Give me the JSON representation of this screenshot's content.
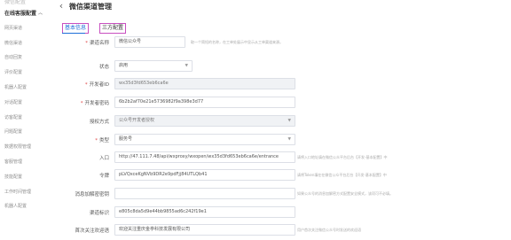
{
  "sidebar": {
    "top_text": "微信配置",
    "group_label": "在线客服配置",
    "items": [
      {
        "label": "网页渠道"
      },
      {
        "label": "微信渠道"
      },
      {
        "label": "自动回复"
      },
      {
        "label": "评价配置"
      },
      {
        "label": "机器人配置"
      },
      {
        "label": "对话配置"
      },
      {
        "label": "访客配置"
      },
      {
        "label": "问题配置"
      },
      {
        "label": "数据权限管理"
      },
      {
        "label": "客服管理"
      },
      {
        "label": "技能配置"
      },
      {
        "label": "工作时间管理"
      },
      {
        "label": "机器人配置"
      }
    ]
  },
  "header": {
    "back_icon": "‹",
    "title": "微信渠道管理"
  },
  "tabs": [
    {
      "label": "基本信息",
      "active": true
    },
    {
      "label": "三方配置",
      "active": false
    }
  ],
  "form": {
    "channel_name": {
      "label": "渠道名称",
      "value": "微信公众号",
      "hint": "取一个简短的名称，在工单处展示中显示从工单渠道来源。"
    },
    "status": {
      "label": "状态",
      "value": "启用"
    },
    "developer_id": {
      "label": "开发者ID",
      "value": "wx35d3fd653eb6ca6e"
    },
    "developer_secret": {
      "label": "开发者密码",
      "value": "6b2b2af70e21e5736982f9a398e3d77"
    },
    "auth_method": {
      "label": "授权方式",
      "value": "公众号开发者授权"
    },
    "type": {
      "label": "类型",
      "value": "服务号"
    },
    "entry": {
      "label": "入口",
      "value": "http://47.111.7.48/api/wxproxy/wxopen/wx35d3fd653eb6ca6e/entrance",
      "hint": "请将入口地址填在微信公众平台后台【开发-基本配置】中"
    },
    "token": {
      "label": "令牌",
      "value": "pLVQxceKgNVb9DR2e9pdFjj84UTLQb41",
      "hint": "请将Token填在在微信公众平台后台【开发-基本配置】中"
    },
    "aes_key": {
      "label": "消息加解密密钥",
      "value": "",
      "hint": "如果公众号的消息加解密方式配置安全模式，该项可不必填。"
    },
    "channel_tag": {
      "label": "渠道标识",
      "value": "e805c8da5d9e44bb9855ad6c242f19e1"
    },
    "welcome": {
      "label": "首次关注欢迎语",
      "value": "欢迎关注重庆金亭科技发展有限公司",
      "hint": "用户首次关注微信公众号时发送的欢迎语"
    }
  },
  "colors": {
    "accent": "#1e6fd9",
    "required": "#e04545",
    "tab_border": "#c850c0"
  }
}
